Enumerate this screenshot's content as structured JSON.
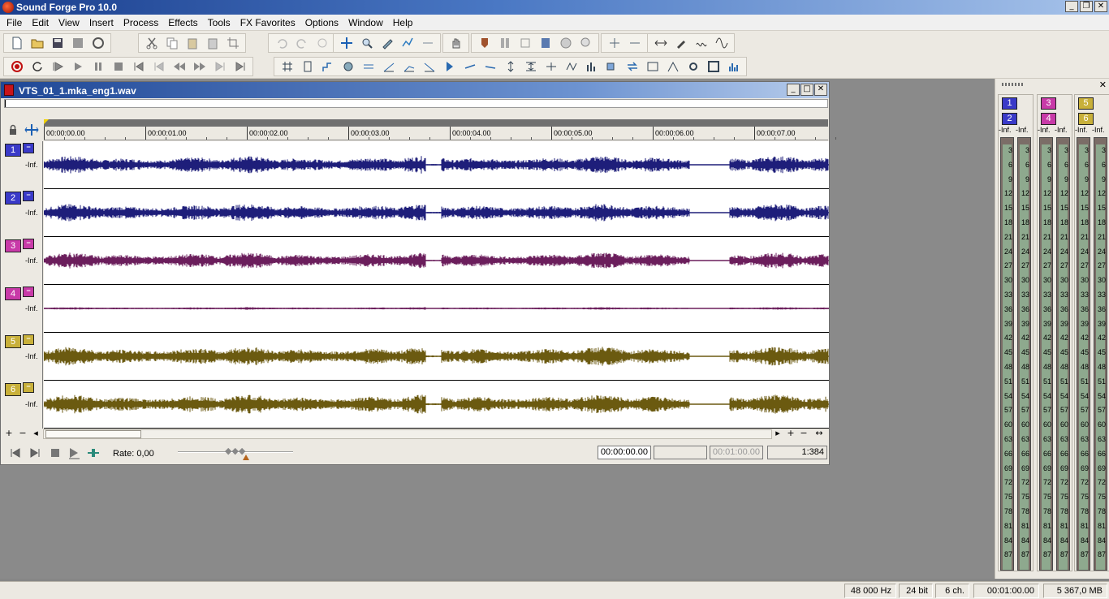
{
  "app": {
    "title": "Sound Forge Pro 10.0"
  },
  "menu": [
    "File",
    "Edit",
    "View",
    "Insert",
    "Process",
    "Effects",
    "Tools",
    "FX Favorites",
    "Options",
    "Window",
    "Help"
  ],
  "data_window": {
    "filename": "VTS_01_1.mka_eng1.wav",
    "ruler_labels": [
      "00:00:00.00",
      "00:00:01.00",
      "00:00:02.00",
      "00:00:03.00",
      "00:00:04.00",
      "00:00:05.00",
      "00:00:06.00",
      "00:00:07.00"
    ],
    "channels": [
      {
        "number": "1",
        "level": "-Inf.",
        "color": "#1e1e7a",
        "badge_color": "#3a3ac8",
        "amplitude": 0.55
      },
      {
        "number": "2",
        "level": "-Inf.",
        "color": "#1e1e7a",
        "badge_color": "#3a3ac8",
        "amplitude": 0.55
      },
      {
        "number": "3",
        "level": "-Inf.",
        "color": "#6b1e5c",
        "badge_color": "#c83aa8",
        "amplitude": 0.5
      },
      {
        "number": "4",
        "level": "-Inf.",
        "color": "#6b1e5c",
        "badge_color": "#c83aa8",
        "amplitude": 0.08
      },
      {
        "number": "5",
        "level": "-Inf.",
        "color": "#6b5a10",
        "badge_color": "#c8b03a",
        "amplitude": 0.6
      },
      {
        "number": "6",
        "level": "-Inf.",
        "color": "#6b5a10",
        "badge_color": "#c8b03a",
        "amplitude": 0.6
      }
    ],
    "transport": {
      "rate_label": "Rate: 0,00",
      "cursor_time": "00:00:00.00",
      "selection_start": "",
      "length": "00:01:00.00",
      "zoom": "1:384"
    }
  },
  "meters": {
    "groups": [
      {
        "buttons": [
          "1",
          "2"
        ],
        "color": "#3a3ac8",
        "infs": [
          "-Inf.",
          "-Inf."
        ]
      },
      {
        "buttons": [
          "3",
          "4"
        ],
        "color": "#c83aa8",
        "infs": [
          "-Inf.",
          "-Inf."
        ]
      },
      {
        "buttons": [
          "5",
          "6"
        ],
        "color": "#c8b03a",
        "infs": [
          "-Inf.",
          "-Inf."
        ]
      }
    ],
    "scale": [
      "3",
      "6",
      "9",
      "12",
      "15",
      "18",
      "21",
      "24",
      "27",
      "30",
      "33",
      "36",
      "39",
      "42",
      "45",
      "48",
      "51",
      "54",
      "57",
      "60",
      "63",
      "66",
      "69",
      "72",
      "75",
      "78",
      "81",
      "84",
      "87"
    ]
  },
  "status": {
    "sample_rate": "48 000 Hz",
    "bit_depth": "24 bit",
    "channels": "6 ch.",
    "length": "00:01:00.00",
    "free_space": "5 367,0 MB"
  }
}
